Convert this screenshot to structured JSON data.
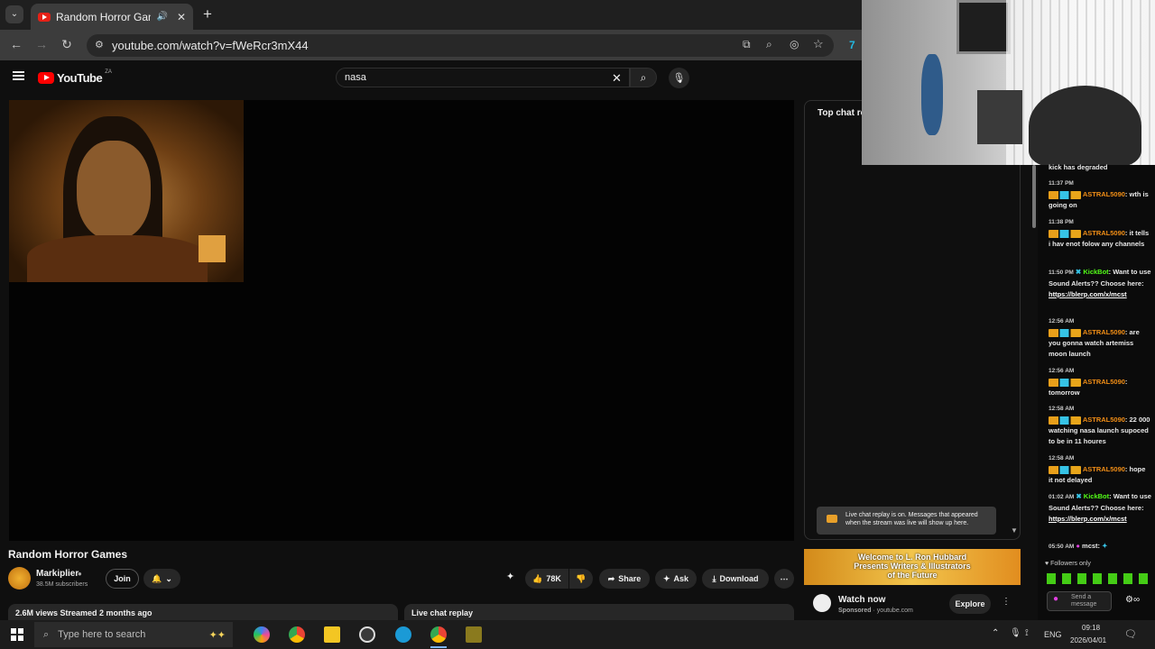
{
  "browser": {
    "tab_title": "Random Horror Games - Yo",
    "url": "youtube.com/watch?v=fWeRcr3mX44"
  },
  "youtube": {
    "logo_text": "YouTube",
    "region": "ZA",
    "search_value": "nasa",
    "video_title": "Random Horror Games",
    "channel_name": "Markiplier",
    "subscribers": "38.5M subscribers",
    "join_label": "Join",
    "likes": "78K",
    "share_label": "Share",
    "ask_label": "Ask",
    "download_label": "Download",
    "description_meta": "2.6M views  Streamed 2 months ago",
    "chat_header": "Top chat re",
    "chat_replay_tab": "Live chat replay",
    "replay_notice": "Live chat replay is on. Messages that appeared when the stream was live will show up here.",
    "ad_line1": "Welcome to L. Ron Hubbard",
    "ad_line2": "Presents Writers & Illustrators",
    "ad_line3": "of the Future",
    "ad_cta": "Watch now",
    "ad_sponsored": "Sponsored",
    "ad_domain": "youtube.com",
    "ad_button": "Explore"
  },
  "kick_chat": {
    "top_text": "kick has degraded",
    "messages": [
      {
        "time": "11:37 PM",
        "user": "ASTRAL5090",
        "text": "wth is going on"
      },
      {
        "time": "11:38 PM",
        "user": "ASTRAL5090",
        "text": "it tells i hav enot folow any channels"
      },
      {
        "time": "11:50 PM",
        "user": "KickBot",
        "text": "Want to use Sound Alerts?? Choose here:",
        "link": "https://blerp.com/x/mcst"
      },
      {
        "time": "12:56 AM",
        "user": "ASTRAL5090",
        "text": "are you gonna watch artemiss moon launch"
      },
      {
        "time": "12:56 AM",
        "user": "ASTRAL5090",
        "text": "tomorrow"
      },
      {
        "time": "12:58 AM",
        "user": "ASTRAL5090",
        "text": "22 000 watching nasa launch supoced to be in 11 houres"
      },
      {
        "time": "12:58 AM",
        "user": "ASTRAL5090",
        "text": "hope it not delayed"
      },
      {
        "time": "01:02 AM",
        "user": "KickBot",
        "text": "Want to use Sound Alerts?? Choose here:",
        "link": "https://blerp.com/x/mcst"
      },
      {
        "time": "05:50 AM",
        "user": "mcst",
        "text": ""
      }
    ],
    "followers_only": "Followers only",
    "send_placeholder": "Send a message"
  },
  "taskbar": {
    "search_placeholder": "Type here to search",
    "language": "ENG",
    "time": "09:18",
    "date": "2026/04/01"
  },
  "colors": {
    "yt_red": "#ff0000",
    "kick_green": "#53fc18",
    "kick_username": "#f18e16"
  }
}
